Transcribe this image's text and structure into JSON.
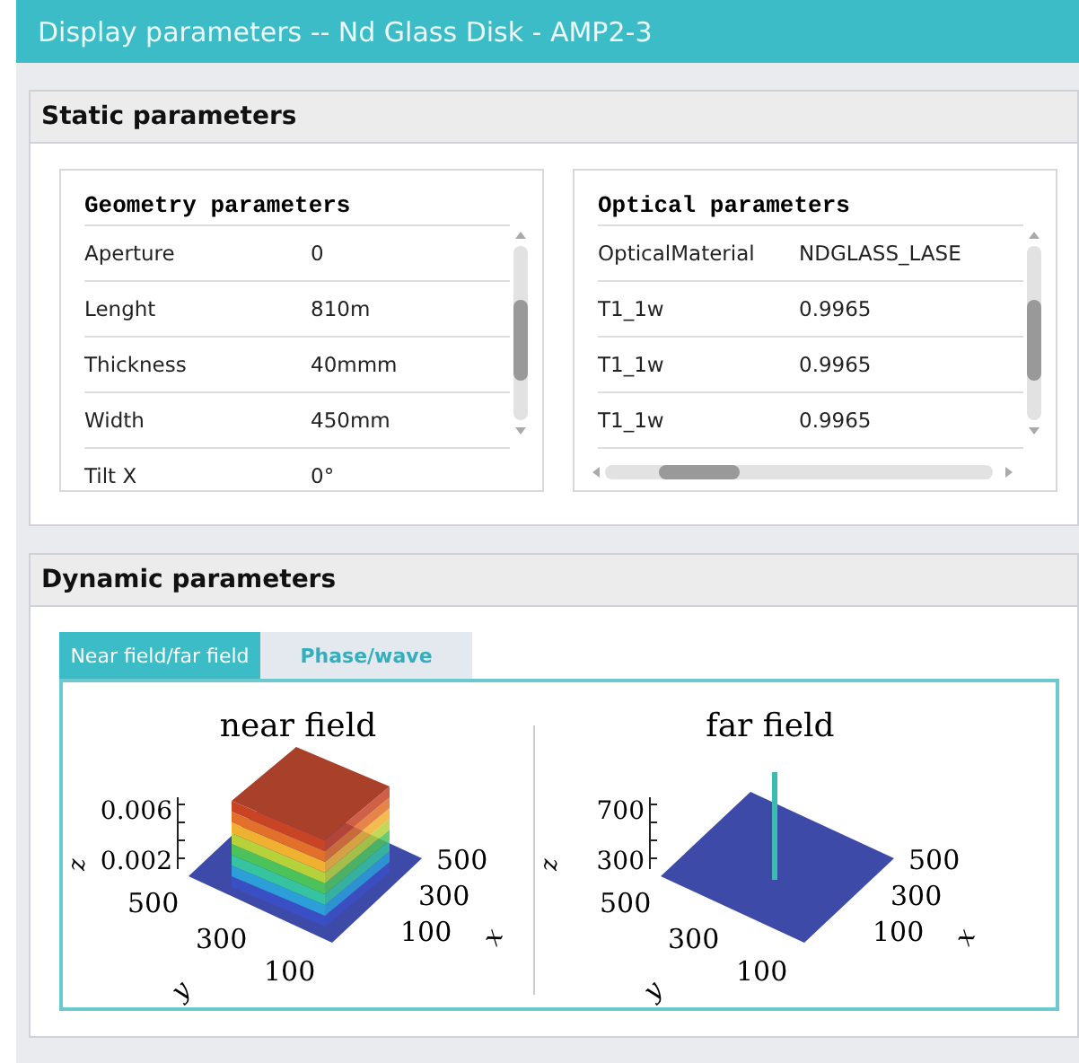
{
  "window": {
    "title": "Display parameters -- Nd Glass Disk - AMP2-3"
  },
  "static_section": {
    "title": "Static parameters",
    "panels": [
      {
        "title": "Geometry parameters",
        "horizontal_scrollbar": false,
        "rows": [
          {
            "name": "Aperture",
            "value": "0"
          },
          {
            "name": "Lenght",
            "value": "810m"
          },
          {
            "name": "Thickness",
            "value": "40mmm"
          },
          {
            "name": "Width",
            "value": "450mm"
          },
          {
            "name": "Tilt X",
            "value": "0°"
          }
        ]
      },
      {
        "title": "Optical parameters",
        "horizontal_scrollbar": true,
        "rows": [
          {
            "name": "OpticalMaterial",
            "value": "NDGLASS_LASE"
          },
          {
            "name": "T1_1w",
            "value": "0.9965"
          },
          {
            "name": "T1_1w",
            "value": "0.9965"
          },
          {
            "name": "T1_1w",
            "value": "0.9965"
          }
        ]
      }
    ]
  },
  "dynamic_section": {
    "title": "Dynamic parameters",
    "tabs": [
      {
        "label": "Near field/far field",
        "selected": true
      },
      {
        "label": "Phase/wave",
        "selected": false
      }
    ],
    "plots": [
      {
        "kind": "plateau",
        "title": "near field",
        "z_label": "z",
        "z_ticks": [
          "0.006",
          "0.002"
        ],
        "x_label": "x",
        "x_ticks": [
          "500",
          "300",
          "100"
        ],
        "y_label": "y",
        "y_ticks": [
          "500",
          "300",
          "100"
        ]
      },
      {
        "kind": "spike",
        "title": "far field",
        "z_label": "z",
        "z_ticks": [
          "700",
          "300"
        ],
        "x_label": "x",
        "x_ticks": [
          "500",
          "300",
          "100"
        ],
        "y_label": "y",
        "y_ticks": [
          "500",
          "300",
          "100"
        ]
      }
    ]
  }
}
